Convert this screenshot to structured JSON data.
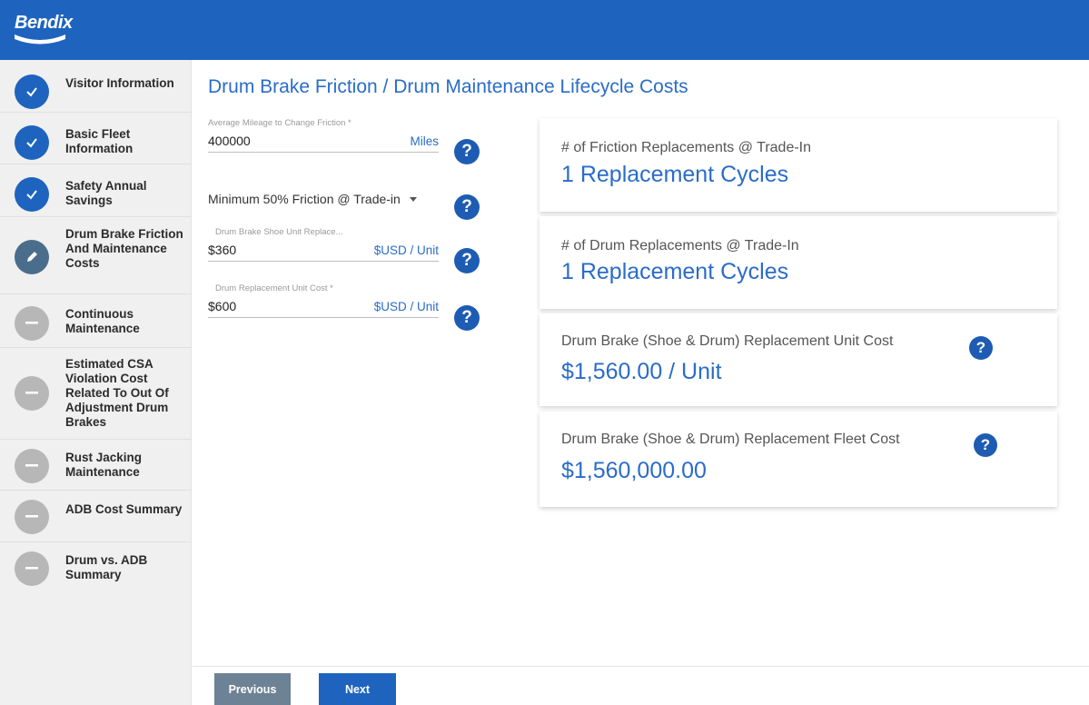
{
  "header": {
    "brand": "Bendix"
  },
  "sidebar": {
    "steps": [
      {
        "label": "Visitor Information",
        "state": "done",
        "icon": "check-icon"
      },
      {
        "label": "Basic Fleet Information",
        "state": "done",
        "icon": "check-icon"
      },
      {
        "label": "Safety Annual Savings",
        "state": "done",
        "icon": "check-icon"
      },
      {
        "label": "Drum Brake Friction And Maintenance Costs",
        "state": "active",
        "icon": "pencil-icon"
      },
      {
        "label": "Continuous Maintenance",
        "state": "pending",
        "icon": "minus-icon"
      },
      {
        "label": "Estimated CSA Violation Cost Related To Out Of Adjustment Drum Brakes",
        "state": "pending",
        "icon": "minus-icon"
      },
      {
        "label": "Rust Jacking Maintenance",
        "state": "pending",
        "icon": "minus-icon"
      },
      {
        "label": "ADB Cost Summary",
        "state": "pending",
        "icon": "minus-icon"
      },
      {
        "label": "Drum vs. ADB Summary",
        "state": "pending",
        "icon": "minus-icon"
      }
    ]
  },
  "main": {
    "title": "Drum Brake Friction / Drum Maintenance Lifecycle Costs",
    "fields": {
      "mileage": {
        "label": "Average Mileage to Change Friction *",
        "value": "400000",
        "unit": "Miles"
      },
      "trade_in": {
        "value": "Minimum 50% Friction @ Trade-in"
      },
      "shoe_cost": {
        "label": "Drum Brake Shoe Unit Replace...",
        "value": "$360",
        "unit": "$USD / Unit"
      },
      "drum_cost": {
        "label": "Drum Replacement Unit Cost *",
        "value": "$600",
        "unit": "$USD / Unit"
      }
    },
    "help_glyph": "?",
    "cards": [
      {
        "title": "# of Friction Replacements @ Trade-In",
        "value": "1 Replacement Cycles"
      },
      {
        "title": "# of Drum Replacements @ Trade-In",
        "value": "1 Replacement Cycles"
      },
      {
        "title": "Drum Brake (Shoe & Drum) Replacement Unit Cost",
        "value": "$1,560.00 / Unit"
      },
      {
        "title": "Drum Brake (Shoe & Drum) Replacement Fleet Cost",
        "value": "$1,560,000.00"
      }
    ]
  },
  "footer": {
    "previous_label": "Previous",
    "next_label": "Next"
  },
  "colors": {
    "header": "#1e64be",
    "accent": "#2a6cc8",
    "step_done": "#1e64be",
    "step_active": "#4a6d8c",
    "step_pending": "#b7b7b7"
  }
}
